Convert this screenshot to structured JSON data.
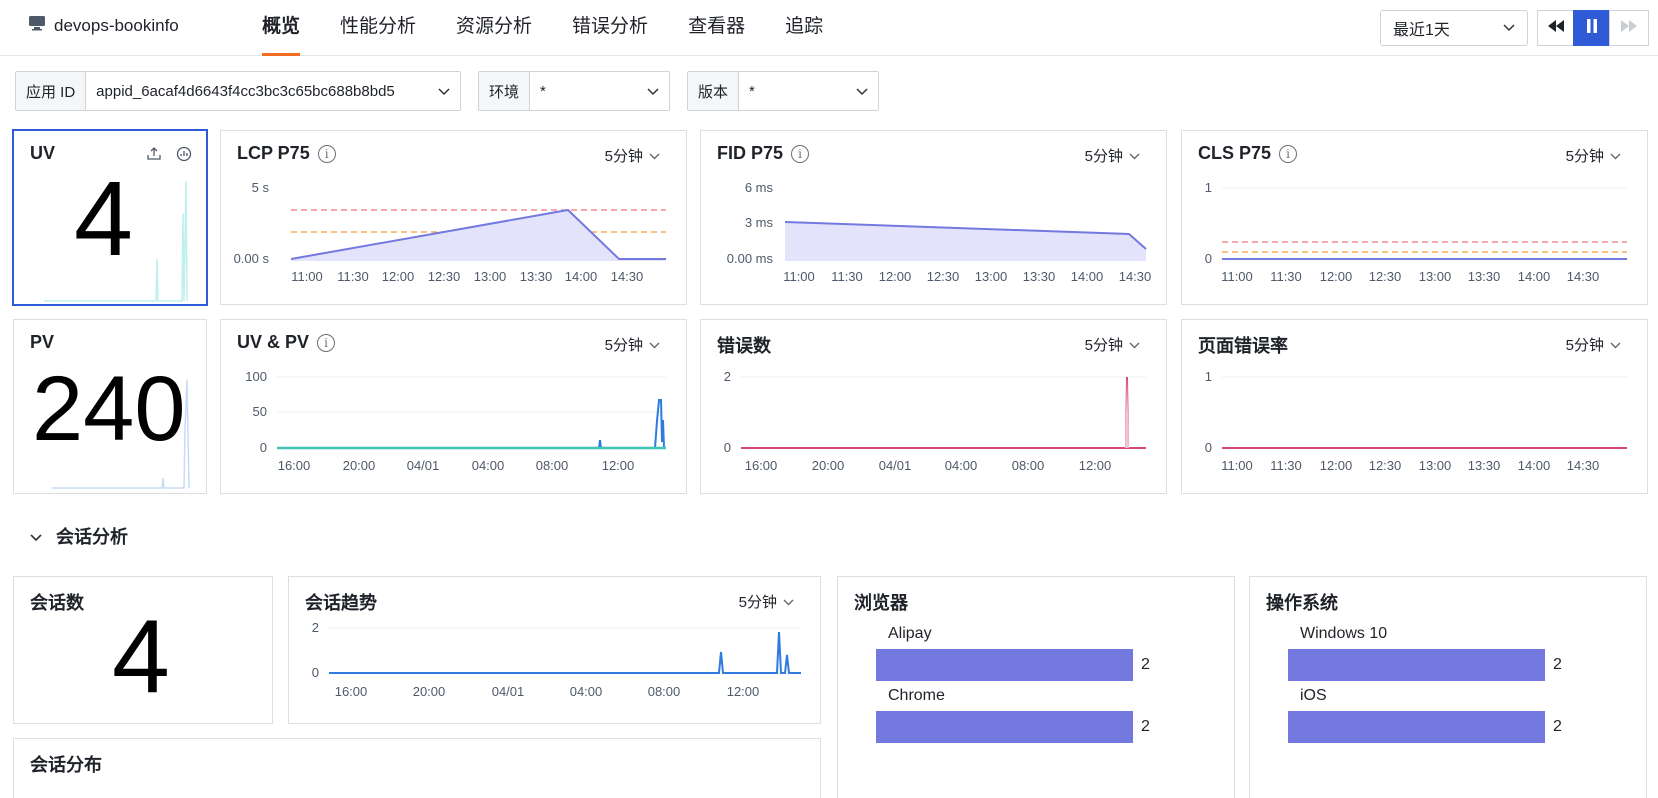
{
  "header": {
    "app_name": "devops-bookinfo",
    "tabs": [
      "概览",
      "性能分析",
      "资源分析",
      "错误分析",
      "查看器",
      "追踪"
    ],
    "time_range": "最近1天"
  },
  "filters": {
    "app_id_label": "应用 ID",
    "app_id_value": "appid_6acaf4d6643f4cc3bc3c65bc688b8bd5",
    "env_label": "环境",
    "env_value": "*",
    "version_label": "版本",
    "version_value": "*"
  },
  "cards": {
    "uv": {
      "title": "UV",
      "value": "4"
    },
    "pv": {
      "title": "PV",
      "value": "240"
    },
    "lcp": {
      "title": "LCP P75",
      "gran": "5分钟",
      "y_ticks": [
        "5 s",
        "0.00 s"
      ],
      "x_ticks": [
        "11:00",
        "11:30",
        "12:00",
        "12:30",
        "13:00",
        "13:30",
        "14:00",
        "14:30"
      ]
    },
    "fid": {
      "title": "FID P75",
      "gran": "5分钟",
      "y_ticks": [
        "6 ms",
        "3 ms",
        "0.00 ms"
      ],
      "x_ticks": [
        "11:00",
        "11:30",
        "12:00",
        "12:30",
        "13:00",
        "13:30",
        "14:00",
        "14:30"
      ]
    },
    "cls": {
      "title": "CLS P75",
      "gran": "5分钟",
      "y_ticks": [
        "1",
        "0"
      ],
      "x_ticks": [
        "11:00",
        "11:30",
        "12:00",
        "12:30",
        "13:00",
        "13:30",
        "14:00",
        "14:30"
      ]
    },
    "uvpv": {
      "title": "UV & PV",
      "gran": "5分钟",
      "y_ticks": [
        "100",
        "50",
        "0"
      ],
      "x_ticks": [
        "16:00",
        "20:00",
        "04/01",
        "04:00",
        "08:00",
        "12:00"
      ]
    },
    "errors": {
      "title": "错误数",
      "gran": "5分钟",
      "y_ticks": [
        "2",
        "0"
      ],
      "x_ticks": [
        "16:00",
        "20:00",
        "04/01",
        "04:00",
        "08:00",
        "12:00"
      ]
    },
    "error_rate": {
      "title": "页面错误率",
      "gran": "5分钟",
      "y_ticks": [
        "1",
        "0"
      ],
      "x_ticks": [
        "11:00",
        "11:30",
        "12:00",
        "12:30",
        "13:00",
        "13:30",
        "14:00",
        "14:30"
      ]
    }
  },
  "session": {
    "section_title": "会话分析",
    "count_title": "会话数",
    "count_value": "4",
    "trend_title": "会话趋势",
    "trend_gran": "5分钟",
    "trend_y_ticks": [
      "2",
      "0"
    ],
    "trend_x_ticks": [
      "16:00",
      "20:00",
      "04/01",
      "04:00",
      "08:00",
      "12:00"
    ],
    "dist_title": "会话分布",
    "browser_title": "浏览器",
    "browsers": [
      {
        "name": "Alipay",
        "value": "2"
      },
      {
        "name": "Chrome",
        "value": "2"
      }
    ],
    "os_title": "操作系统",
    "os": [
      {
        "name": "Windows 10",
        "value": "2"
      },
      {
        "name": "iOS",
        "value": "2"
      }
    ]
  },
  "colors": {
    "accent": "#2f5bd6",
    "tab_underline": "#f26d22",
    "series_purple": "#7479e0",
    "error_red": "#d9467a",
    "uv_teal": "#3fc4b6",
    "pv_blue": "#2f7be0"
  }
}
